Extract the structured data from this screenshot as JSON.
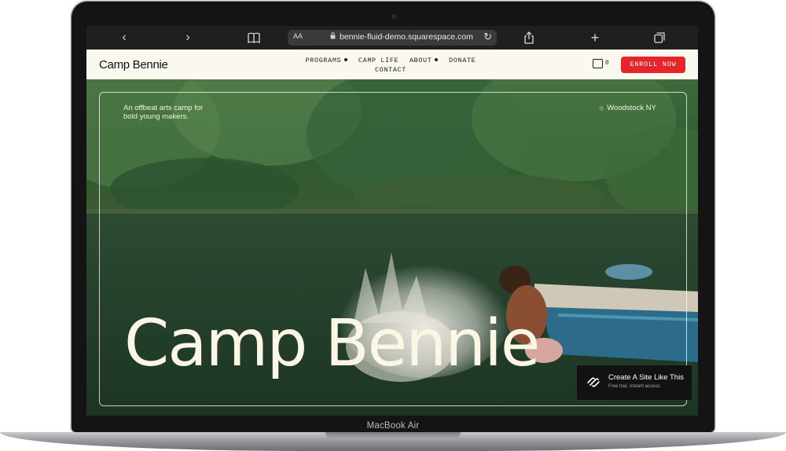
{
  "device": {
    "label": "MacBook Air"
  },
  "browser": {
    "text_size_label": "AA",
    "url": "bennie-fluid-demo.squarespace.com",
    "icons": [
      "chevron-left-icon",
      "chevron-right-icon",
      "book-icon",
      "lock-icon",
      "reload-icon",
      "share-icon",
      "plus-icon",
      "tabs-icon"
    ]
  },
  "site": {
    "logo": "Camp Bennie",
    "nav": [
      {
        "label": "PROGRAMS",
        "has_dropdown": true
      },
      {
        "label": "CAMP LIFE",
        "has_dropdown": false
      },
      {
        "label": "ABOUT",
        "has_dropdown": true
      },
      {
        "label": "DONATE",
        "has_dropdown": false
      },
      {
        "label": "CONTACT",
        "has_dropdown": false
      }
    ],
    "cart_count": "0",
    "cta_label": "ENROLL NOW",
    "accent_color": "#e5242b",
    "header_bg": "#fbf8ef"
  },
  "hero": {
    "tagline": "An offbeat arts camp for bold young makers.",
    "location": "Woodstock NY",
    "title": "Camp Bennie"
  },
  "badge": {
    "title": "Create A Site Like This",
    "subtitle": "Free trial. Instant access."
  }
}
